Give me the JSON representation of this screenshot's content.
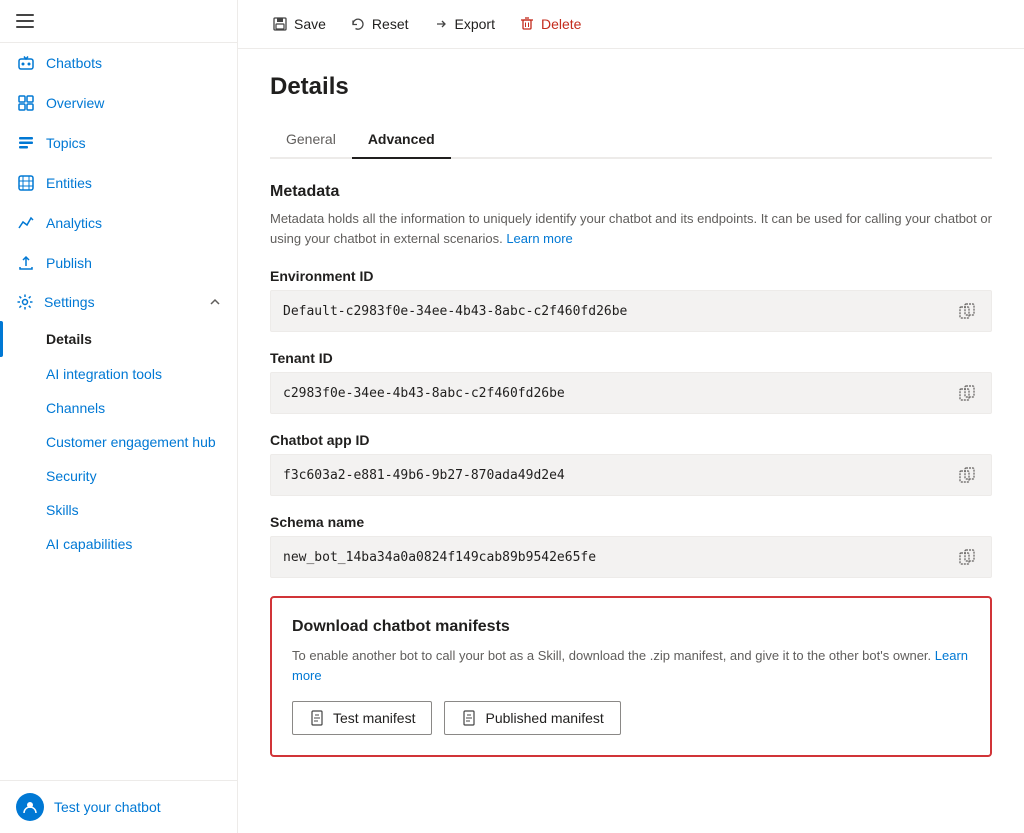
{
  "sidebar": {
    "hamburger_label": "Menu",
    "items": [
      {
        "id": "chatbots",
        "label": "Chatbots",
        "icon": "chatbots-icon"
      },
      {
        "id": "overview",
        "label": "Overview",
        "icon": "overview-icon"
      },
      {
        "id": "topics",
        "label": "Topics",
        "icon": "topics-icon"
      },
      {
        "id": "entities",
        "label": "Entities",
        "icon": "entities-icon"
      },
      {
        "id": "analytics",
        "label": "Analytics",
        "icon": "analytics-icon"
      },
      {
        "id": "publish",
        "label": "Publish",
        "icon": "publish-icon"
      },
      {
        "id": "settings",
        "label": "Settings",
        "icon": "settings-icon"
      }
    ],
    "settings_sub_items": [
      {
        "id": "details",
        "label": "Details",
        "active": true
      },
      {
        "id": "ai-integration-tools",
        "label": "AI integration tools"
      },
      {
        "id": "channels",
        "label": "Channels"
      },
      {
        "id": "customer-engagement-hub",
        "label": "Customer engagement hub"
      },
      {
        "id": "security",
        "label": "Security"
      },
      {
        "id": "skills",
        "label": "Skills"
      },
      {
        "id": "ai-capabilities",
        "label": "AI capabilities"
      }
    ],
    "footer": {
      "label": "Test your chatbot",
      "icon": "test-icon"
    }
  },
  "toolbar": {
    "save_label": "Save",
    "reset_label": "Reset",
    "export_label": "Export",
    "delete_label": "Delete"
  },
  "page": {
    "title": "Details",
    "tabs": [
      {
        "id": "general",
        "label": "General"
      },
      {
        "id": "advanced",
        "label": "Advanced",
        "active": true
      }
    ]
  },
  "metadata": {
    "section_title": "Metadata",
    "section_desc": "Metadata holds all the information to uniquely identify your chatbot and its endpoints. It can be used for calling your chatbot or using your chatbot in external scenarios.",
    "learn_more_link": "Learn more",
    "fields": [
      {
        "id": "environment-id",
        "label": "Environment ID",
        "value": "Default-c2983f0e-34ee-4b43-8abc-c2f460fd26be"
      },
      {
        "id": "tenant-id",
        "label": "Tenant ID",
        "value": "c2983f0e-34ee-4b43-8abc-c2f460fd26be"
      },
      {
        "id": "chatbot-app-id",
        "label": "Chatbot app ID",
        "value": "f3c603a2-e881-49b6-9b27-870ada49d2e4"
      },
      {
        "id": "schema-name",
        "label": "Schema name",
        "value": "new_bot_14ba34a0a0824f149cab89b9542e65fe"
      }
    ]
  },
  "download_manifests": {
    "title": "Download chatbot manifests",
    "desc": "To enable another bot to call your bot as a Skill, download the .zip manifest, and give it to the other bot's owner.",
    "learn_more_link": "Learn more",
    "buttons": [
      {
        "id": "test-manifest",
        "label": "Test manifest"
      },
      {
        "id": "published-manifest",
        "label": "Published manifest"
      }
    ]
  }
}
